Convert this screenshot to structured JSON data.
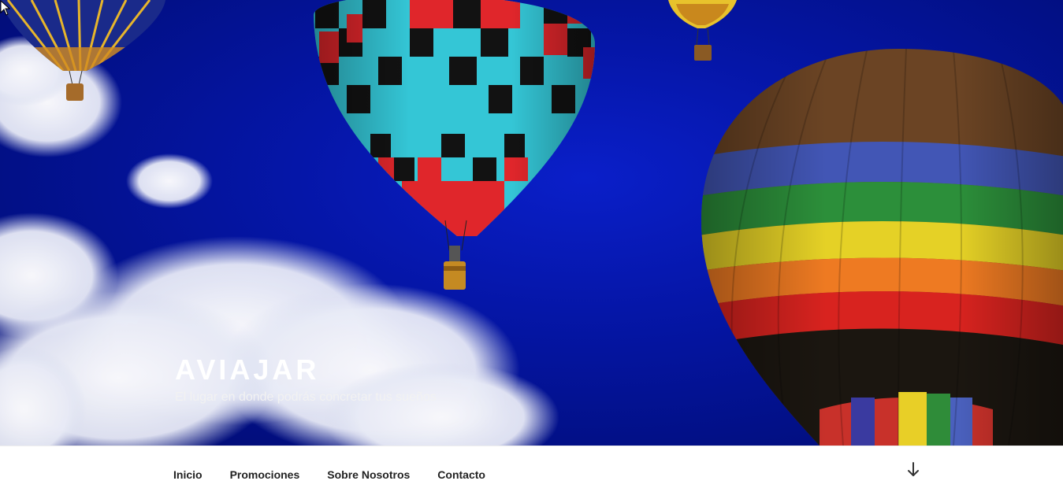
{
  "site": {
    "title": "AVIAJAR",
    "description": "El lugar en donde podrás concretar tus sueños"
  },
  "navigation": {
    "items": [
      {
        "label": "Inicio"
      },
      {
        "label": "Promociones"
      },
      {
        "label": "Sobre Nosotros"
      },
      {
        "label": "Contacto"
      }
    ],
    "scroll_icon": "arrow-down-icon"
  },
  "colors": {
    "sky": "#0516a8",
    "text_light": "#ffffff",
    "menu_text": "#222222"
  }
}
